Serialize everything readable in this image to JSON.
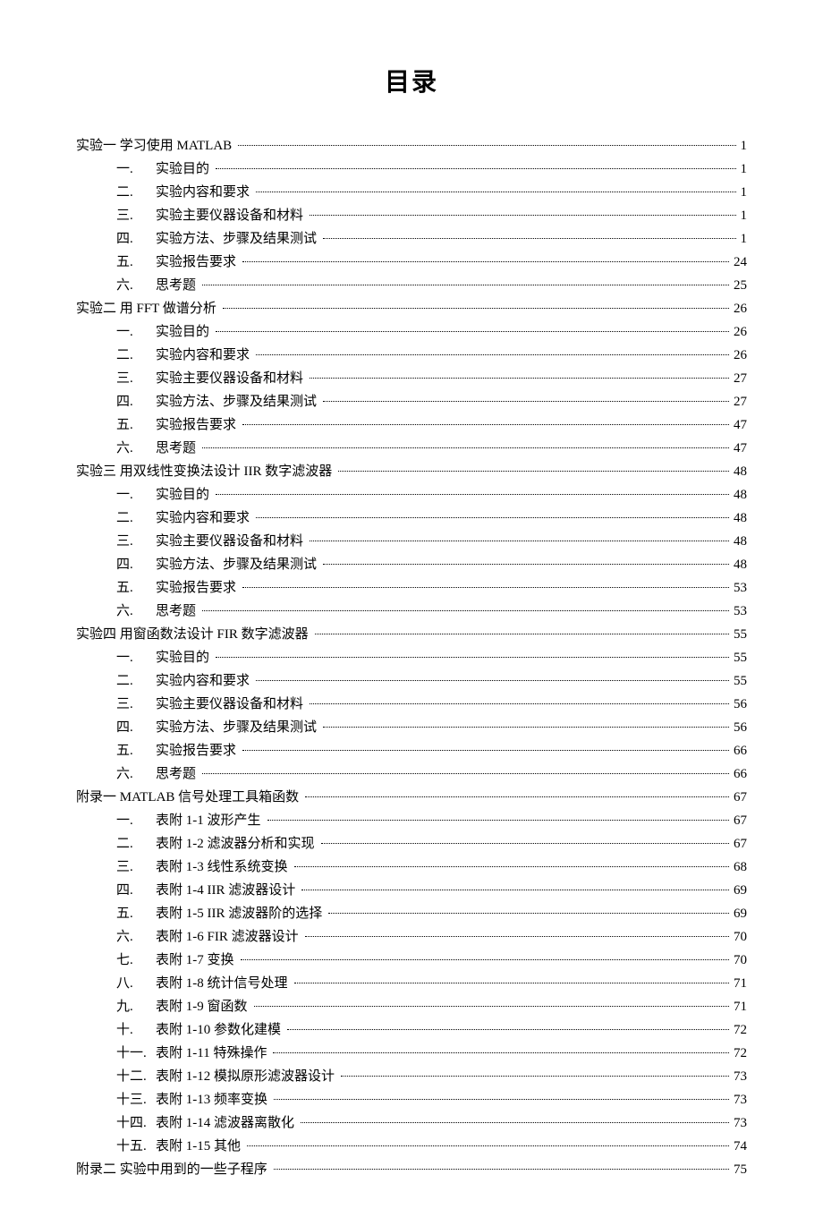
{
  "title": "目录",
  "toc": [
    {
      "level": 0,
      "num": "",
      "text": "实验一  学习使用 MATLAB",
      "page": "1"
    },
    {
      "level": 1,
      "num": "一.",
      "text": "实验目的",
      "page": "1"
    },
    {
      "level": 1,
      "num": "二.",
      "text": "实验内容和要求",
      "page": "1"
    },
    {
      "level": 1,
      "num": "三.",
      "text": "实验主要仪器设备和材料",
      "page": "1"
    },
    {
      "level": 1,
      "num": "四.",
      "text": "实验方法、步骤及结果测试",
      "page": "1"
    },
    {
      "level": 1,
      "num": "五.",
      "text": "实验报告要求",
      "page": "24"
    },
    {
      "level": 1,
      "num": "六.",
      "text": "思考题",
      "page": "25"
    },
    {
      "level": 0,
      "num": "",
      "text": "实验二  用 FFT 做谱分析",
      "page": "26"
    },
    {
      "level": 1,
      "num": "一.",
      "text": "实验目的",
      "page": "26"
    },
    {
      "level": 1,
      "num": "二.",
      "text": "实验内容和要求",
      "page": "26"
    },
    {
      "level": 1,
      "num": "三.",
      "text": "实验主要仪器设备和材料",
      "page": "27"
    },
    {
      "level": 1,
      "num": "四.",
      "text": "实验方法、步骤及结果测试",
      "page": "27"
    },
    {
      "level": 1,
      "num": "五.",
      "text": "实验报告要求",
      "page": "47"
    },
    {
      "level": 1,
      "num": "六.",
      "text": "思考题",
      "page": "47"
    },
    {
      "level": 0,
      "num": "",
      "text": "实验三  用双线性变换法设计 IIR 数字滤波器",
      "page": "48"
    },
    {
      "level": 1,
      "num": "一.",
      "text": "实验目的",
      "page": "48"
    },
    {
      "level": 1,
      "num": "二.",
      "text": "实验内容和要求",
      "page": "48"
    },
    {
      "level": 1,
      "num": "三.",
      "text": "实验主要仪器设备和材料",
      "page": "48"
    },
    {
      "level": 1,
      "num": "四.",
      "text": "实验方法、步骤及结果测试",
      "page": "48"
    },
    {
      "level": 1,
      "num": "五.",
      "text": "实验报告要求",
      "page": "53"
    },
    {
      "level": 1,
      "num": "六.",
      "text": "思考题",
      "page": "53"
    },
    {
      "level": 0,
      "num": "",
      "text": "实验四  用窗函数法设计 FIR 数字滤波器",
      "page": "55"
    },
    {
      "level": 1,
      "num": "一.",
      "text": "实验目的",
      "page": "55"
    },
    {
      "level": 1,
      "num": "二.",
      "text": "实验内容和要求",
      "page": "55"
    },
    {
      "level": 1,
      "num": "三.",
      "text": "实验主要仪器设备和材料",
      "page": "56"
    },
    {
      "level": 1,
      "num": "四.",
      "text": "实验方法、步骤及结果测试",
      "page": "56"
    },
    {
      "level": 1,
      "num": "五.",
      "text": "实验报告要求",
      "page": "66"
    },
    {
      "level": 1,
      "num": "六.",
      "text": "思考题",
      "page": "66"
    },
    {
      "level": 0,
      "num": "",
      "text": "附录一  MATLAB 信号处理工具箱函数",
      "page": "67"
    },
    {
      "level": 1,
      "num": "一.",
      "text": "表附 1-1  波形产生",
      "page": "67"
    },
    {
      "level": 1,
      "num": "二.",
      "text": "表附 1-2  滤波器分析和实现",
      "page": "67"
    },
    {
      "level": 1,
      "num": "三.",
      "text": "表附 1-3  线性系统变换",
      "page": "68"
    },
    {
      "level": 1,
      "num": "四.",
      "text": "表附 1-4 IIR 滤波器设计",
      "page": "69"
    },
    {
      "level": 1,
      "num": "五.",
      "text": "表附 1-5 IIR 滤波器阶的选择",
      "page": "69"
    },
    {
      "level": 1,
      "num": "六.",
      "text": "表附 1-6 FIR 滤波器设计",
      "page": "70"
    },
    {
      "level": 1,
      "num": "七.",
      "text": "表附 1-7  变换",
      "page": "70"
    },
    {
      "level": 1,
      "num": "八.",
      "text": "表附 1-8  统计信号处理",
      "page": "71"
    },
    {
      "level": 1,
      "num": "九.",
      "text": "表附 1-9  窗函数",
      "page": "71"
    },
    {
      "level": 1,
      "num": "十.",
      "text": "表附 1-10  参数化建模",
      "page": "72"
    },
    {
      "level": 1,
      "num": "十一.",
      "text": "表附 1-11  特殊操作",
      "page": "72"
    },
    {
      "level": 1,
      "num": "十二.",
      "text": "表附 1-12  模拟原形滤波器设计",
      "page": "73"
    },
    {
      "level": 1,
      "num": "十三.",
      "text": "表附 1-13  频率变换",
      "page": "73"
    },
    {
      "level": 1,
      "num": "十四.",
      "text": "表附 1-14  滤波器离散化",
      "page": "73"
    },
    {
      "level": 1,
      "num": "十五.",
      "text": "表附 1-15  其他",
      "page": "74"
    },
    {
      "level": 0,
      "num": "",
      "text": "附录二  实验中用到的一些子程序",
      "page": "75"
    }
  ]
}
